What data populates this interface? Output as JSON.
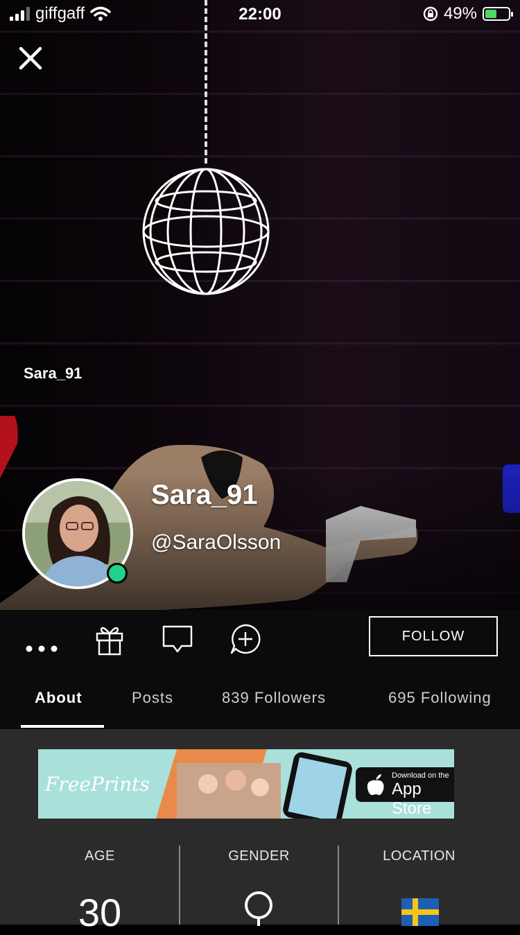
{
  "status_bar": {
    "carrier": "giffgaff",
    "time": "22:00",
    "battery_percent": "49%",
    "battery_level": 0.49
  },
  "hero": {
    "scene_label": "Sara_91"
  },
  "profile": {
    "display_name": "Sara_91",
    "handle": "@SaraOlsson",
    "online": true,
    "online_color": "#1fd38a"
  },
  "actions": {
    "icons": [
      "more-icon",
      "gift-icon",
      "message-icon",
      "add-chat-icon"
    ],
    "follow_label": "FOLLOW"
  },
  "tabs": [
    {
      "label": "About",
      "active": true
    },
    {
      "label": "Posts",
      "active": false
    },
    {
      "label": "839 Followers",
      "active": false
    },
    {
      "label": "695 Following",
      "active": false
    }
  ],
  "ad": {
    "brand": "FreePrints",
    "store_small": "Download on the",
    "store_big": "App Store"
  },
  "stats": {
    "age_label": "AGE",
    "age_value": "30",
    "gender_label": "GENDER",
    "gender_icon": "female-icon",
    "location_label": "LOCATION",
    "location_icon": "sweden-flag-icon"
  }
}
